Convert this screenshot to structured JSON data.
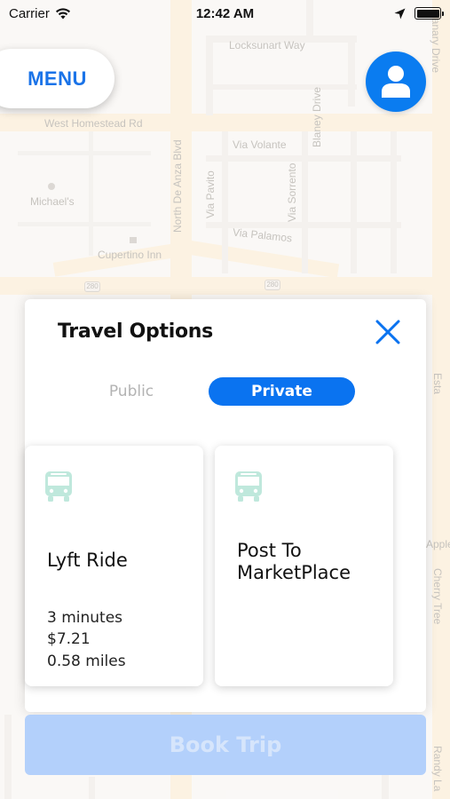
{
  "status_bar": {
    "carrier": "Carrier",
    "time": "12:42 AM",
    "battery_level": 1.0
  },
  "map": {
    "labels": {
      "locksunart": "Locksunart Way",
      "homestead": "West Homestead Rd",
      "via_volante": "Via Volante",
      "michaels": "Michael's",
      "cupertino_inn": "Cupertino Inn",
      "via_palamos": "Via Palamos",
      "de_anza": "North De Anza Blvd",
      "via_pavito": "Via Pavito",
      "via_sorrento": "Via Sorrento",
      "blaney": "Blaney Drive",
      "canary": "Canary Drive",
      "esta": "Esta",
      "apple": "Apple",
      "cherry": "Cherry Tree",
      "randy": "Randy La",
      "hwy_a": "280",
      "hwy_b": "280"
    }
  },
  "menu": {
    "label": "MENU"
  },
  "avatar": {
    "icon": "user-icon"
  },
  "travel_options": {
    "title": "Travel Options",
    "close_icon": "close-icon",
    "segments": {
      "public": "Public",
      "private": "Private",
      "selected": "Private"
    },
    "cards": [
      {
        "icon": "bus-icon",
        "title": "Lyft Ride",
        "details": [
          "3 minutes",
          "$7.21",
          "0.58 miles"
        ]
      },
      {
        "icon": "bus-icon",
        "title_lines": [
          "Post To",
          "MarketPlace"
        ]
      }
    ]
  },
  "book_trip": {
    "label": "Book Trip"
  },
  "colors": {
    "accent": "#0a73f0",
    "menu_text": "#1a73e8",
    "bus_icon": "#bfe8dc",
    "book_disabled": "#b3d0fb"
  }
}
